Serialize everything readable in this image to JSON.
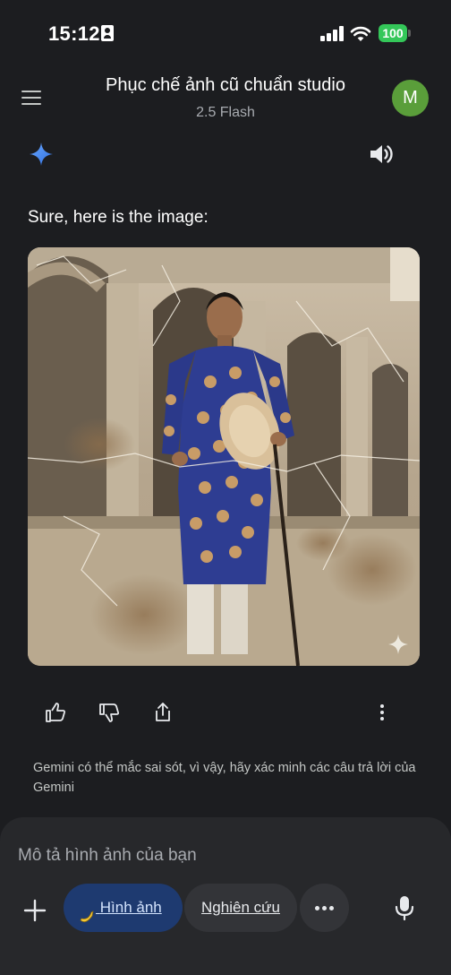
{
  "status_bar": {
    "time": "15:12",
    "battery": "100"
  },
  "header": {
    "title": "Phục chế ảnh cũ chuẩn studio",
    "subtitle": "2.5 Flash",
    "avatar_letter": "M"
  },
  "message": {
    "text": "Sure, here is the image:"
  },
  "disclaimer": "Gemini có thể mắc sai sót, vì vậy, hãy xác minh các câu trả lời của Gemini",
  "composer": {
    "placeholder": "Mô tả hình ảnh của bạn",
    "chip_image_label": "Hình ảnh",
    "chip_research_label": "Nghiên cứu"
  },
  "icons": [
    "menu-icon",
    "sparkle-icon",
    "speaker-icon",
    "thumbs-up-icon",
    "thumbs-down-icon",
    "share-icon",
    "more-vert-icon",
    "plus-icon",
    "banana-icon",
    "more-horiz-icon",
    "mic-icon"
  ],
  "colors": {
    "background": "#1c1d20",
    "composer": "#27282b",
    "chip_active": "#1e3a70",
    "avatar": "#5a9e3a",
    "battery": "#34c759",
    "accent_blue": "#4a8cf7"
  }
}
